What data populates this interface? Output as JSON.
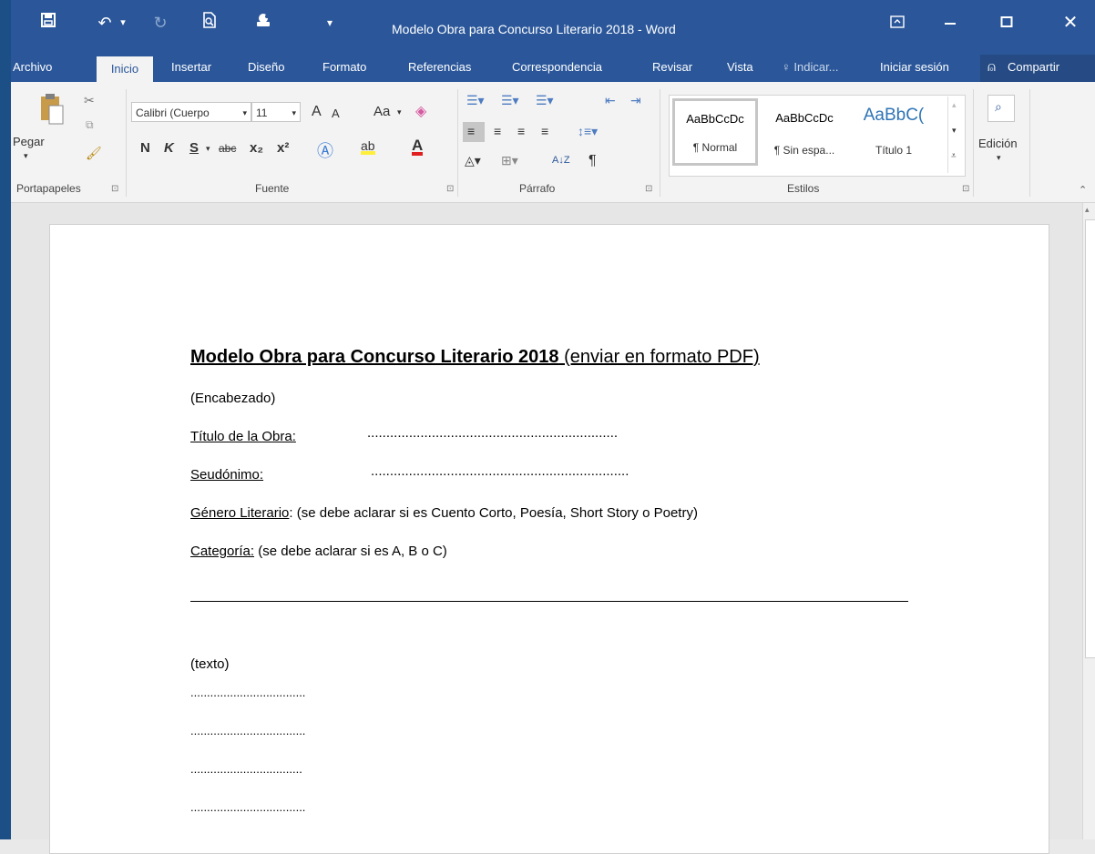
{
  "window": {
    "title": "Modelo Obra para Concurso Literario 2018 - Word",
    "quick_access_customize": "▾",
    "undo_dropdown": "▾"
  },
  "tabs": {
    "archivo": "Archivo",
    "inicio": "Inicio",
    "insertar": "Insertar",
    "diseno": "Diseño",
    "formato": "Formato",
    "referencias": "Referencias",
    "correspondencia": "Correspondencia",
    "revisar": "Revisar",
    "vista": "Vista",
    "tell_me": "Indicar...",
    "sign_in": "Iniciar sesión",
    "share": "Compartir"
  },
  "ribbon": {
    "clipboard": {
      "paste": "Pegar",
      "group": "Portapapeles"
    },
    "font": {
      "font_name": "Calibri (Cuerpo",
      "font_size": "11",
      "grow": "A",
      "shrink": "A",
      "change_case": "Aa",
      "bold": "N",
      "italic": "K",
      "underline": "S",
      "strike": "abc",
      "subscript": "x₂",
      "superscript": "x²",
      "group": "Fuente"
    },
    "paragraph": {
      "group": "Párrafo",
      "sort": "A↓Z",
      "pilcrow": "¶"
    },
    "styles": {
      "group": "Estilos",
      "items": [
        {
          "sample": "AaBbCcDc",
          "name": "¶ Normal"
        },
        {
          "sample": "AaBbCcDc",
          "name": "¶ Sin espa..."
        },
        {
          "sample": "AaBbC(",
          "name": "Título 1"
        }
      ]
    },
    "editing": {
      "label": "Edición"
    }
  },
  "document": {
    "heading_bold": "Modelo Obra para Concurso Literario 2018",
    "heading_rest": " (enviar en formato PDF)",
    "encabezado": "(Encabezado)",
    "titulo_label": "Título de la Obra:",
    "titulo_dots": "..................................................................",
    "seudonimo_label": "Seudónimo:",
    "seudonimo_dots": "....................................................................",
    "genero_label": "Género Literario",
    "genero_rest": ": (se debe aclarar si es Cuento Corto, Poesía, Short Story o Poetry)",
    "categoria_label": "Categoría:",
    "categoria_rest": " (se debe aclarar si es A, B o C)",
    "texto": "(texto)",
    "dots_lines": [
      "...................................",
      "...................................",
      "..................................",
      "..................................."
    ]
  },
  "colors": {
    "word_blue": "#2b579a",
    "ribbon_bg": "#f3f3f3",
    "doc_bg": "#e6e6e6",
    "style_accent": "#2e74b5"
  }
}
